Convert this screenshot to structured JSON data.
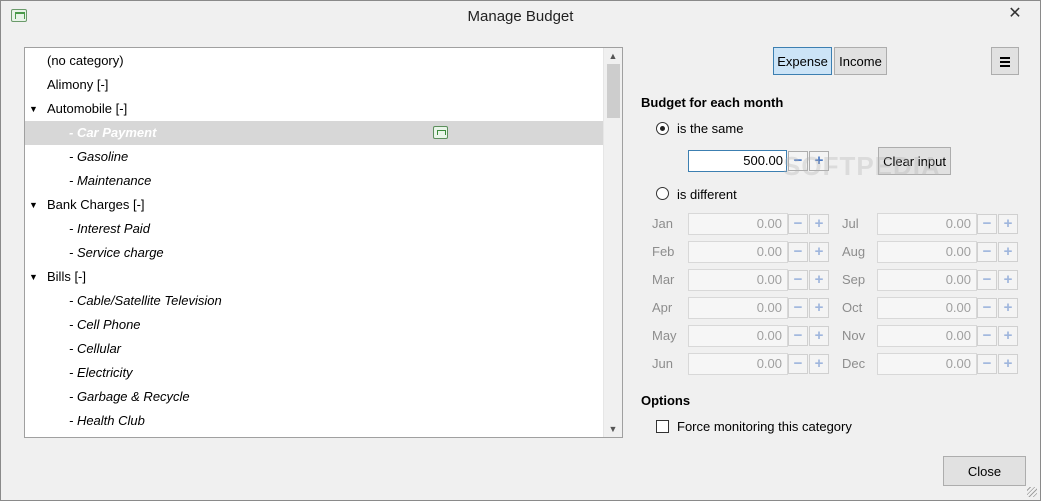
{
  "window": {
    "title": "Manage Budget",
    "close_glyph": "✕"
  },
  "tree": {
    "items": [
      {
        "label": "(no category)",
        "level": 0,
        "expanded": false,
        "selected": false
      },
      {
        "label": "Alimony [-]",
        "level": 0,
        "expanded": false,
        "selected": false
      },
      {
        "label": "Automobile [-]",
        "level": 0,
        "expanded": true,
        "selected": false
      },
      {
        "label": "- Car Payment",
        "level": 1,
        "selected": true,
        "icon": "budget-icon"
      },
      {
        "label": "- Gasoline",
        "level": 1,
        "selected": false
      },
      {
        "label": "- Maintenance",
        "level": 1,
        "selected": false
      },
      {
        "label": "Bank Charges [-]",
        "level": 0,
        "expanded": true,
        "selected": false
      },
      {
        "label": "- Interest Paid",
        "level": 1,
        "selected": false
      },
      {
        "label": "- Service charge",
        "level": 1,
        "selected": false
      },
      {
        "label": "Bills [-]",
        "level": 0,
        "expanded": true,
        "selected": false
      },
      {
        "label": "- Cable/Satellite Television",
        "level": 1,
        "selected": false
      },
      {
        "label": "- Cell Phone",
        "level": 1,
        "selected": false
      },
      {
        "label": "- Cellular",
        "level": 1,
        "selected": false
      },
      {
        "label": "- Electricity",
        "level": 1,
        "selected": false
      },
      {
        "label": "- Garbage & Recycle",
        "level": 1,
        "selected": false
      },
      {
        "label": "- Health Club",
        "level": 1,
        "selected": false
      }
    ]
  },
  "toggle": {
    "expense": "Expense",
    "income": "Income",
    "active": "expense"
  },
  "budget": {
    "heading": "Budget for each month",
    "same_label": "is the same",
    "different_label": "is different",
    "same_value": "500.00",
    "clear_label": "Clear input",
    "selected_mode": "same"
  },
  "months": [
    {
      "name": "Jan",
      "value": "0.00"
    },
    {
      "name": "Feb",
      "value": "0.00"
    },
    {
      "name": "Mar",
      "value": "0.00"
    },
    {
      "name": "Apr",
      "value": "0.00"
    },
    {
      "name": "May",
      "value": "0.00"
    },
    {
      "name": "Jun",
      "value": "0.00"
    },
    {
      "name": "Jul",
      "value": "0.00"
    },
    {
      "name": "Aug",
      "value": "0.00"
    },
    {
      "name": "Sep",
      "value": "0.00"
    },
    {
      "name": "Oct",
      "value": "0.00"
    },
    {
      "name": "Nov",
      "value": "0.00"
    },
    {
      "name": "Dec",
      "value": "0.00"
    }
  ],
  "options": {
    "heading": "Options",
    "force_label": "Force monitoring this category",
    "force_checked": false
  },
  "footer": {
    "close_label": "Close"
  },
  "watermark": "SOFTPEDIA"
}
